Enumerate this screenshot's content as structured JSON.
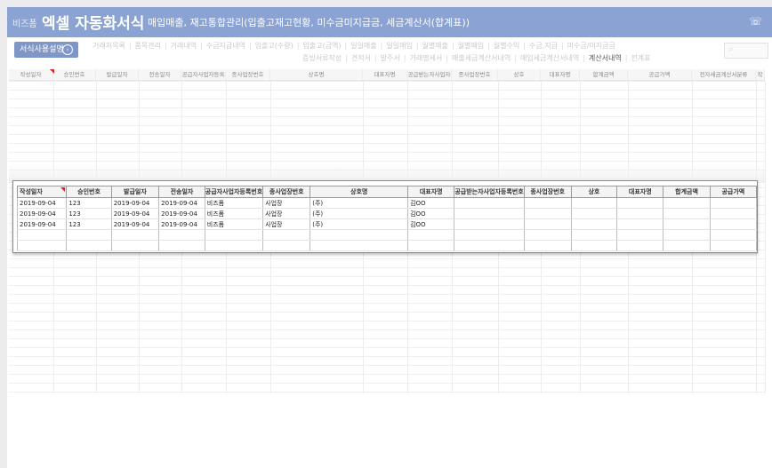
{
  "header": {
    "brand_small": "비즈폼",
    "brand_title": "엑셀 자동화서식",
    "subtitle": "매입매출, 재고통합관리(입출고재고현황, 미수금미지급금, 세금계산서(합계표))",
    "phone_icon": "phone-icon"
  },
  "toolbar": {
    "help_label": "서식사용설명",
    "menu_row1": [
      "거래처목록",
      "품목관리",
      "거래내역",
      "수금지급내역",
      "입출고(수량)",
      "입출고(금액)",
      "일일매출",
      "일일매입",
      "월별매출",
      "월별매입",
      "월별수익",
      "수금,지급",
      "미수금/미지급금"
    ],
    "menu_row2": [
      "증빙서류작성",
      "견적서",
      "발주서",
      "거래명세서",
      "매출세금계산서내역",
      "매입세금계산서내역",
      "계산서내역",
      "전계표"
    ],
    "active_item": "계산서내역"
  },
  "background_table": {
    "headers": [
      "작성일자",
      "승인번호",
      "발급일자",
      "전송일자",
      "공급자사업자등록번호",
      "종사업장번호",
      "상호명",
      "대표자명",
      "공급받는자사업자등록번호",
      "종사업장번호",
      "상호",
      "대표자명",
      "합계금액",
      "공급가액",
      "전자세금계산서분류",
      "작"
    ]
  },
  "popup_table": {
    "headers": [
      "작성일자",
      "승인번호",
      "발급일자",
      "전송일자",
      "공급자사업자등록번호",
      "종사업장번호",
      "상호명",
      "대표자명",
      "공급받는자사업자등록번호",
      "종사업장번호",
      "상호",
      "대표자명",
      "합계금액",
      "공급가액"
    ],
    "rows": [
      [
        "2019-09-04",
        "123",
        "2019-09-04",
        "2019-09-04",
        "비즈폼",
        "사업장",
        "(주)",
        "김OO",
        "",
        "",
        "",
        "",
        "",
        ""
      ],
      [
        "2019-09-04",
        "123",
        "2019-09-04",
        "2019-09-04",
        "비즈폼",
        "사업장",
        "(주)",
        "김OO",
        "",
        "",
        "",
        "",
        "",
        ""
      ],
      [
        "2019-09-04",
        "123",
        "2019-09-04",
        "2019-09-04",
        "비즈폼",
        "사업장",
        "(주)",
        "김OO",
        "",
        "",
        "",
        "",
        "",
        ""
      ],
      [
        "",
        "",
        "",
        "",
        "",
        "",
        "",
        "",
        "",
        "",
        "",
        "",
        "",
        ""
      ],
      [
        "",
        "",
        "",
        "",
        "",
        "",
        "",
        "",
        "",
        "",
        "",
        "",
        "",
        ""
      ]
    ]
  },
  "colors": {
    "header_bar": "#8aa3d2",
    "button": "#7f97c6",
    "required_marker": "#dd2233"
  }
}
